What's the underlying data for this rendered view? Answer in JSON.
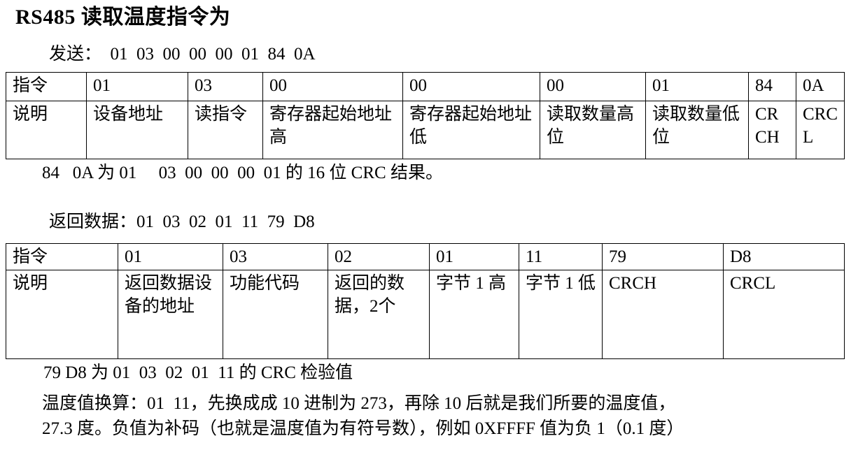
{
  "document": {
    "title": "RS485 读取温度指令为"
  },
  "send_section": {
    "send_line": "发送：  01  03  00  00  00  01  84  0A",
    "table": {
      "columns_label_row": "指令",
      "columns_desc_row": "说明",
      "hex_values": [
        "01",
        "03",
        "00",
        "00",
        "00",
        "01",
        "84",
        "0A"
      ],
      "descriptions": [
        "设备地址",
        "读指令",
        "寄存器起始地址高",
        "寄存器起始地址低",
        "读取数量高位",
        "读取数量低位",
        "CRCH",
        "CRCL"
      ]
    },
    "crc_note": "84   0A 为 01     03  00  00  00  01 的 16 位 CRC 结果。"
  },
  "receive_section": {
    "return_line": "返回数据：01  03  02  01  11  79  D8",
    "table": {
      "columns_label_row": "指令",
      "columns_desc_row": "说明",
      "hex_values": [
        "01",
        "03",
        "02",
        "01",
        "11",
        "79",
        "D8"
      ],
      "descriptions": [
        "返回数据设备的地址",
        "功能代码",
        "返回的数据，2个",
        "字节 1 高",
        "字节 1 低",
        "CRCH",
        "CRCL"
      ]
    },
    "crc_note": "79 D8 为 01  03  02  01  11 的 CRC 检验值",
    "conversion_note_line1": "温度值换算：01  11，先换成成 10 进制为 273，再除 10 后就是我们所要的温度值，",
    "conversion_note_line2": "27.3 度。负值为补码（也就是温度值为有符号数），例如 0XFFFF 值为负 1（0.1 度）"
  }
}
